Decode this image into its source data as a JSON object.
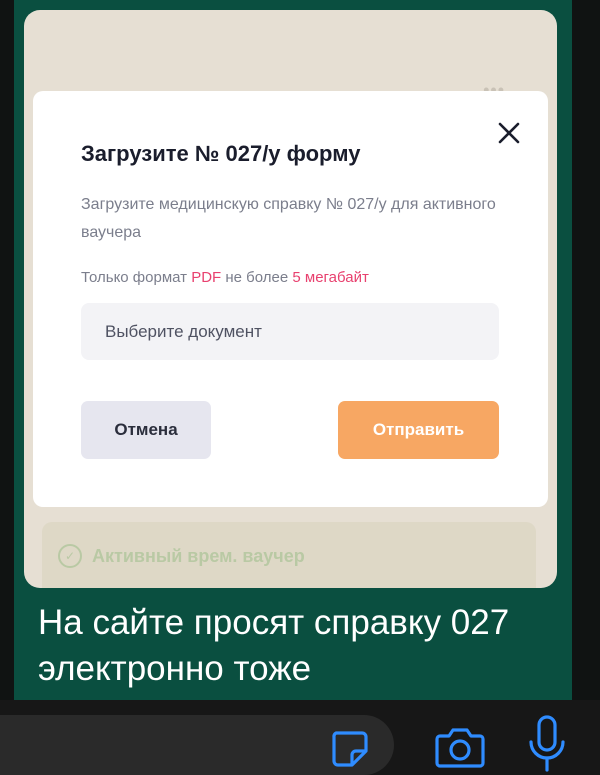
{
  "modal": {
    "title": "Загрузите № 027/у форму",
    "description": "Загрузите медицинскую справку № 027/у для активного ваучера",
    "format_prefix": "Только формат ",
    "format_type": "PDF",
    "format_middle": " не более ",
    "format_size": "5 мегабайт",
    "file_placeholder": "Выберите документ",
    "cancel_label": "Отмена",
    "submit_label": "Отправить",
    "close_icon": "close-icon"
  },
  "background_card": {
    "voucher_label": "Активный врем. ваучер",
    "menu_dots": "•••",
    "check_icon": "check-circle-icon"
  },
  "message": {
    "text": "На сайте просят справку 027 электронно тоже"
  },
  "input_bar": {
    "icons": [
      "sticker-icon",
      "camera-icon",
      "microphone-icon"
    ]
  },
  "colors": {
    "bubble": "#0a4f40",
    "accent_pink": "#e8416f",
    "submit_orange": "#f7a763",
    "icon_blue": "#2f8cff"
  }
}
